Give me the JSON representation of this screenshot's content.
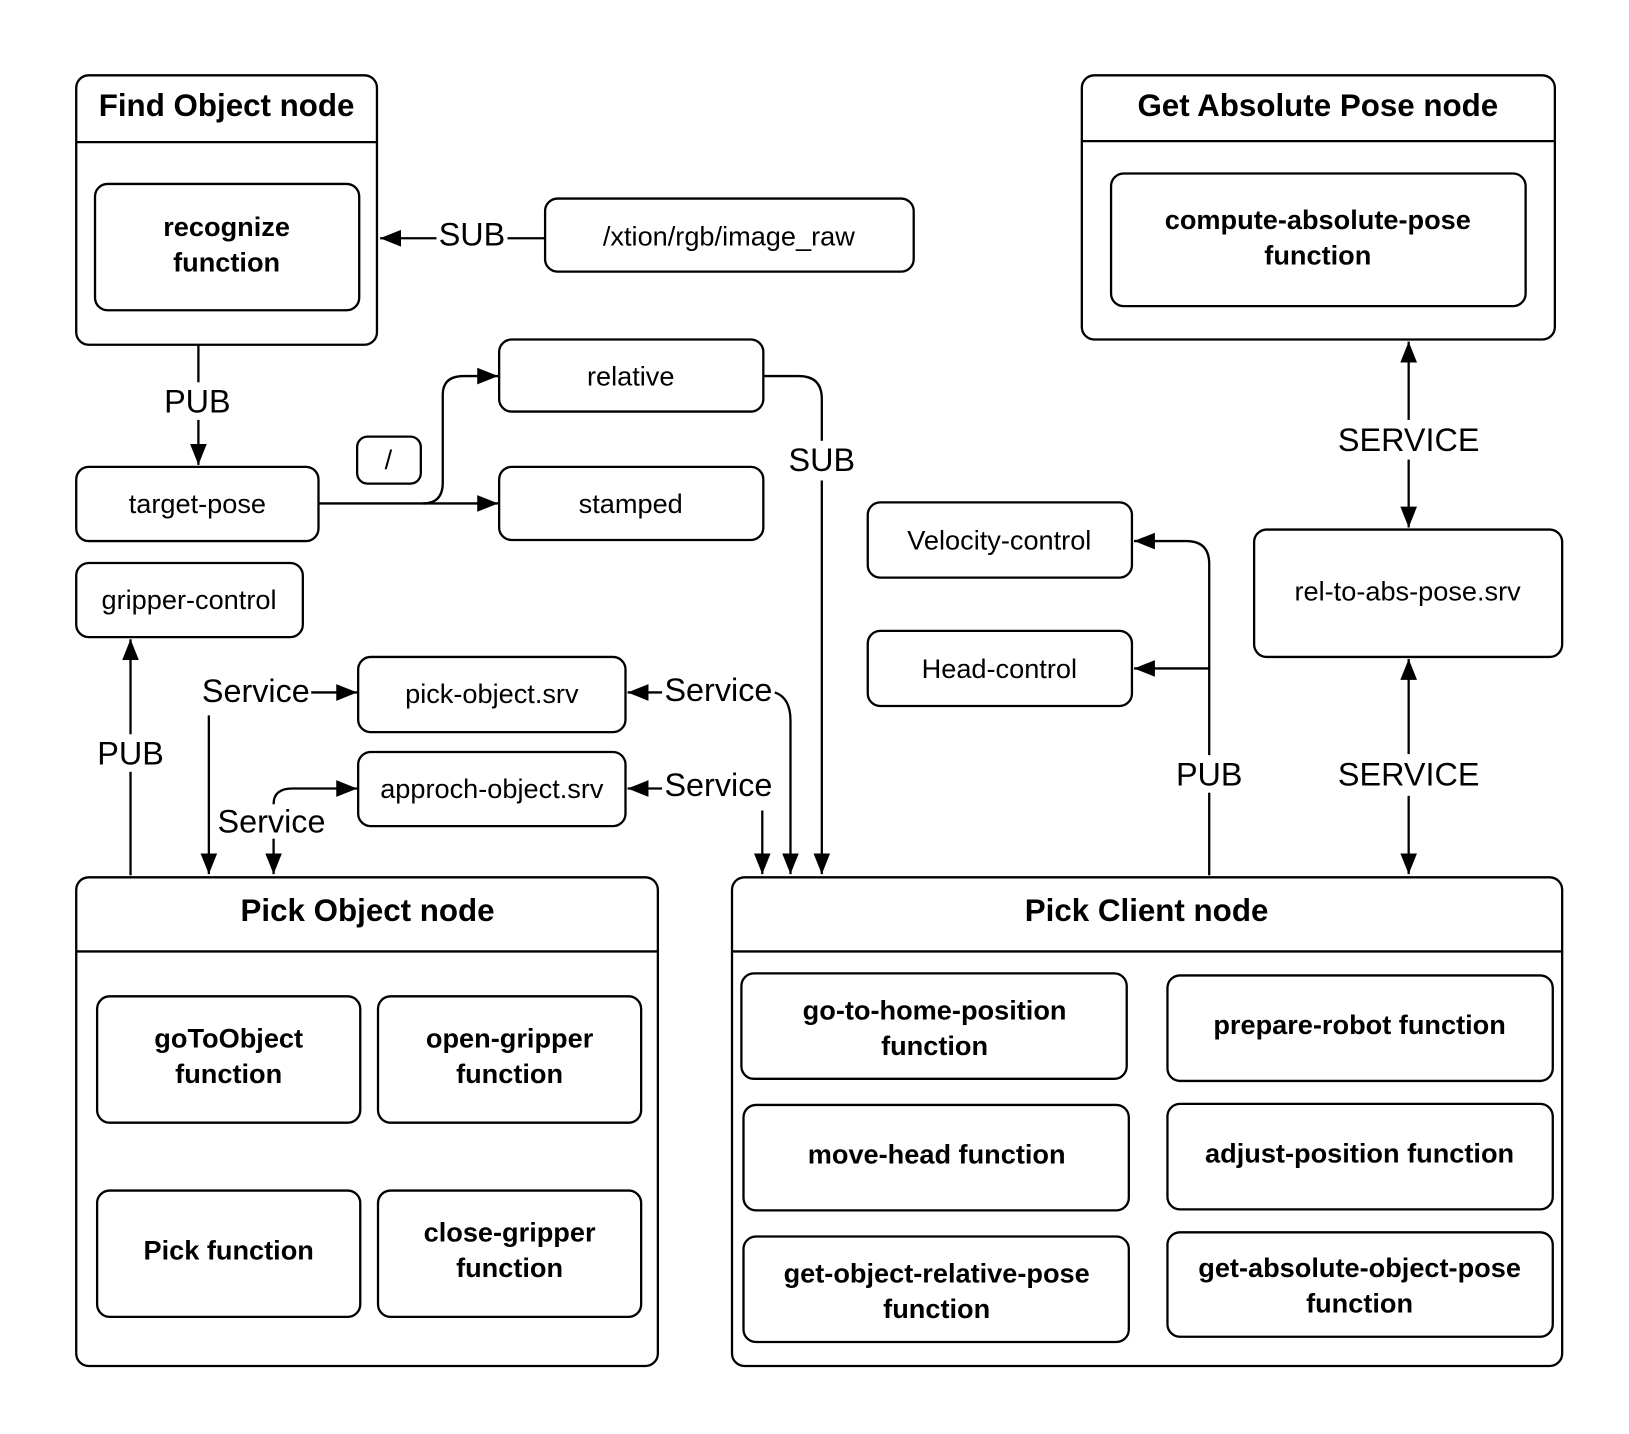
{
  "colors": {
    "stroke": "#000000",
    "background": "#ffffff"
  },
  "find_object_node": {
    "title": "Find Object node",
    "function": [
      "recognize",
      "function"
    ]
  },
  "get_absolute_pose_node": {
    "title": "Get Absolute Pose node",
    "function": [
      "compute-absolute-pose",
      "function"
    ]
  },
  "pick_object_node": {
    "title": "Pick Object node",
    "functions": [
      [
        "goToObject",
        "function"
      ],
      [
        "open-gripper",
        "function"
      ],
      [
        "Pick function"
      ],
      [
        "close-gripper",
        "function"
      ]
    ]
  },
  "pick_client_node": {
    "title": "Pick Client node",
    "functions": [
      [
        "go-to-home-position",
        "function"
      ],
      [
        "prepare-robot function"
      ],
      [
        "move-head function"
      ],
      [
        "adjust-position function"
      ],
      [
        "get-object-relative-pose",
        "function"
      ],
      [
        "get-absolute-object-pose",
        "function"
      ]
    ]
  },
  "topics": {
    "image_raw": "/xtion/rgb/image_raw",
    "target_pose": "target-pose",
    "relative": "relative",
    "stamped": "stamped",
    "slash": "/",
    "gripper_control": "gripper-control",
    "pick_object_srv": "pick-object.srv",
    "approch_object_srv": "approch-object.srv",
    "velocity_control": "Velocity-control",
    "head_control": "Head-control",
    "rel_to_abs_srv": "rel-to-abs-pose.srv"
  },
  "edges": {
    "sub_image": "SUB",
    "pub_target": "PUB",
    "sub_relative": "SUB",
    "pub_gripper": "PUB",
    "service_pick_left": "Service",
    "service_approach_left": "Service",
    "service_pick_right": "Service",
    "service_approach_right": "Service",
    "pub_client": "PUB",
    "service_top": "SERVICE",
    "service_bottom": "SERVICE"
  }
}
